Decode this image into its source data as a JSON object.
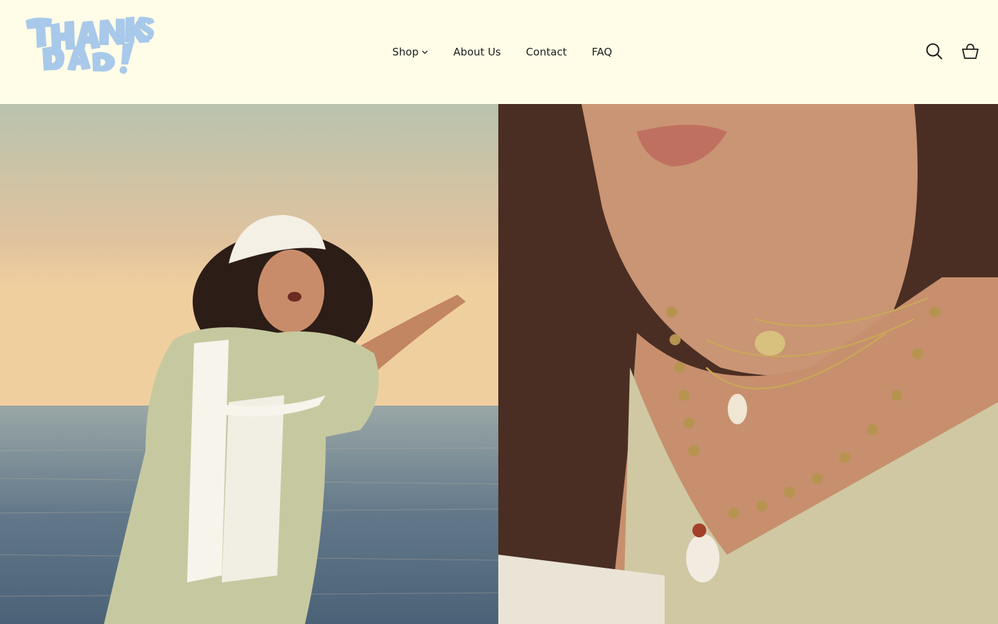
{
  "brand": {
    "logo_alt": "THANKS DAD!",
    "logo_color": "#a9c9ea"
  },
  "nav": {
    "items": [
      {
        "label": "Shop",
        "has_dropdown": true
      },
      {
        "label": "About Us"
      },
      {
        "label": "Contact"
      },
      {
        "label": "FAQ"
      }
    ]
  },
  "actions": {
    "search_icon": "search-icon",
    "cart_icon": "shopping-basket-icon"
  },
  "hero": {
    "left_image": "woman-pointing-at-sea",
    "right_image": "necklaces-closeup"
  },
  "colors": {
    "header_bg": "#fffde8",
    "text": "#1d1d1d",
    "logo": "#a9c9ea"
  }
}
